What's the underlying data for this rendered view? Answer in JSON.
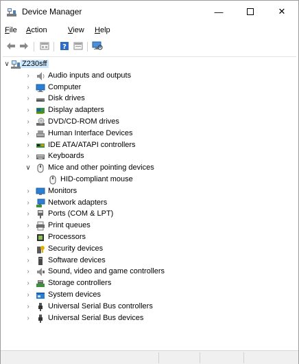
{
  "window": {
    "title": "Device Manager"
  },
  "controls": {
    "minimize": "—",
    "close": "✕"
  },
  "menu": [
    {
      "label": "File",
      "accel": "F",
      "rest": "ile"
    },
    {
      "label": "Action",
      "accel": "A",
      "rest": "ction"
    },
    {
      "label": "View",
      "accel": "V",
      "rest": "iew"
    },
    {
      "label": "Help",
      "accel": "H",
      "rest": "elp"
    }
  ],
  "toolbar": {
    "buttons": [
      "back-icon",
      "forward-icon",
      "properties-icon",
      "help-icon",
      "update-driver-icon",
      "scan-hardware-icon"
    ]
  },
  "tree": {
    "root": {
      "label": "Z230sff",
      "expanded": true
    },
    "items": [
      {
        "label": "Audio inputs and outputs",
        "icon": "speaker-icon",
        "expanded": false
      },
      {
        "label": "Computer",
        "icon": "computer-icon",
        "expanded": false
      },
      {
        "label": "Disk drives",
        "icon": "disk-drive-icon",
        "expanded": false
      },
      {
        "label": "Display adapters",
        "icon": "display-adapter-icon",
        "expanded": false
      },
      {
        "label": "DVD/CD-ROM drives",
        "icon": "dvd-drive-icon",
        "expanded": false
      },
      {
        "label": "Human Interface Devices",
        "icon": "hid-icon",
        "expanded": false
      },
      {
        "label": "IDE ATA/ATAPI controllers",
        "icon": "ide-controller-icon",
        "expanded": false
      },
      {
        "label": "Keyboards",
        "icon": "keyboard-icon",
        "expanded": false
      },
      {
        "label": "Mice and other pointing devices",
        "icon": "mouse-icon",
        "expanded": true,
        "children": [
          {
            "label": "HID-compliant mouse",
            "icon": "mouse-icon"
          }
        ]
      },
      {
        "label": "Monitors",
        "icon": "monitor-icon",
        "expanded": false
      },
      {
        "label": "Network adapters",
        "icon": "network-adapter-icon",
        "expanded": false
      },
      {
        "label": "Ports (COM & LPT)",
        "icon": "port-icon",
        "expanded": false
      },
      {
        "label": "Print queues",
        "icon": "printer-icon",
        "expanded": false
      },
      {
        "label": "Processors",
        "icon": "processor-icon",
        "expanded": false
      },
      {
        "label": "Security devices",
        "icon": "security-device-icon",
        "expanded": false
      },
      {
        "label": "Software devices",
        "icon": "software-device-icon",
        "expanded": false
      },
      {
        "label": "Sound, video and game controllers",
        "icon": "sound-controller-icon",
        "expanded": false
      },
      {
        "label": "Storage controllers",
        "icon": "storage-controller-icon",
        "expanded": false
      },
      {
        "label": "System devices",
        "icon": "system-devices-icon",
        "expanded": false
      },
      {
        "label": "Universal Serial Bus controllers",
        "icon": "usb-icon",
        "expanded": false
      },
      {
        "label": "Universal Serial Bus devices",
        "icon": "usb-icon",
        "expanded": false
      }
    ]
  },
  "colors": {
    "selection": "#cce8ff",
    "accent": "#0078d7"
  }
}
